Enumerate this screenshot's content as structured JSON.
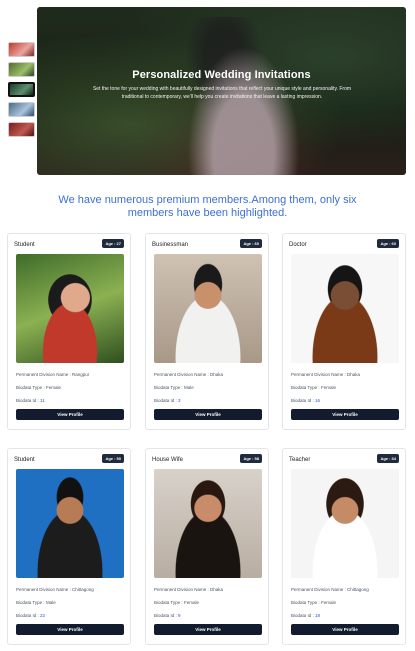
{
  "hero": {
    "title": "Personalized Wedding Invitations",
    "text": "Set the tone for your wedding with beautifully designed invitations that reflect your unique style and personality. From traditional to contemporary, we'll help you create invitations that leave a lasting impression.",
    "thumbnails": [
      "thumb-1",
      "thumb-2",
      "thumb-3",
      "thumb-4",
      "thumb-5"
    ],
    "active_thumbnail": 3
  },
  "headline": "We have numerous premium members.Among them, only six members have been highlighted.",
  "labels": {
    "division": "Permanent Division Name : ",
    "type": "Biodata Type : ",
    "id": "Biodata Id : ",
    "button": "View Profile"
  },
  "members": [
    {
      "occupation": "Student",
      "age": "Age : 27",
      "division": "Rangpur",
      "type": "Female",
      "id": "11"
    },
    {
      "occupation": "Businessman",
      "age": "Age : 60",
      "division": "Dhaka",
      "type": "Male",
      "id": "3"
    },
    {
      "occupation": "Doctor",
      "age": "Age : 60",
      "division": "Dhaka",
      "type": "Female",
      "id": "16"
    },
    {
      "occupation": "Student",
      "age": "Age : 50",
      "division": "Chittagong",
      "type": "Male",
      "id": "22"
    },
    {
      "occupation": "House Wife",
      "age": "Age : 58",
      "division": "Dhaka",
      "type": "Female",
      "id": "9"
    },
    {
      "occupation": "Teacher",
      "age": "Age : 34",
      "division": "Chittagong",
      "type": "Female",
      "id": "18"
    }
  ],
  "colors": {
    "accent": "#3b6fd6",
    "button": "#131c2e",
    "badge": "#1f2a3d"
  }
}
